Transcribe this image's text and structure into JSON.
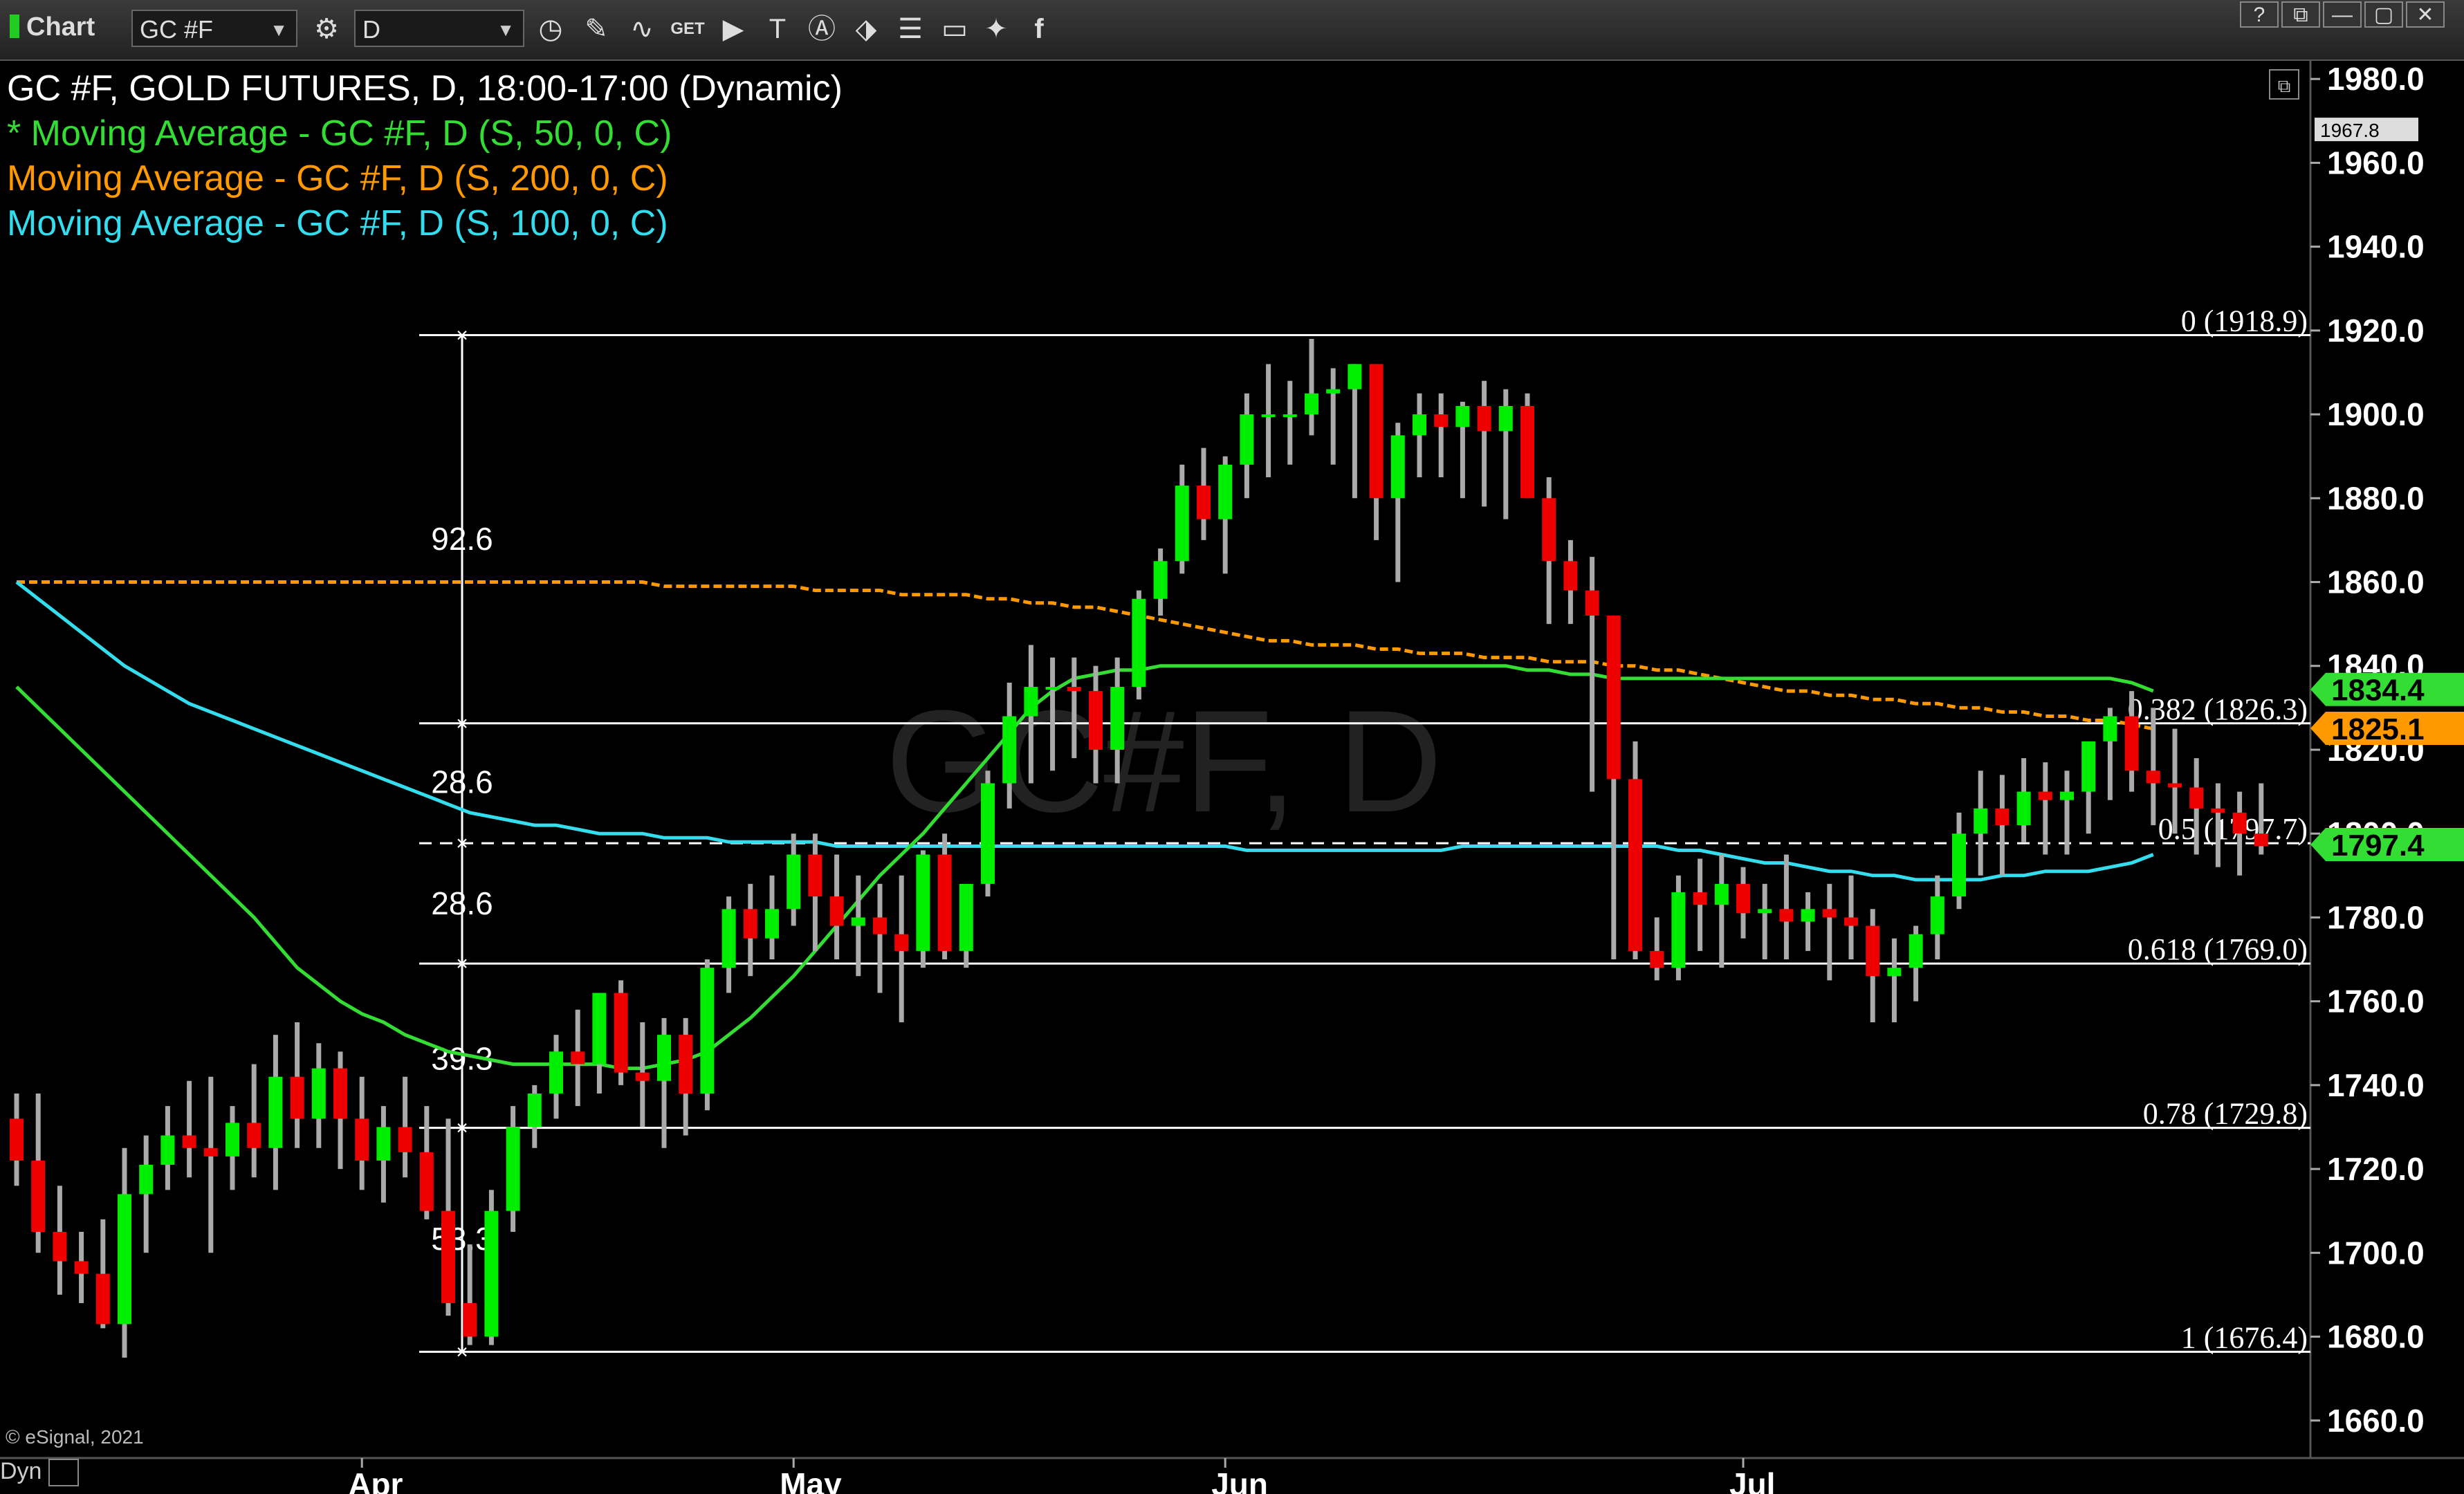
{
  "toolbar": {
    "title": "Chart",
    "symbol": "GC #F",
    "interval": "D",
    "icons": [
      "link-settings-icon",
      "clock-icon",
      "pencil-icon",
      "line-chart-icon",
      "get-icon",
      "play-icon",
      "text-tool-icon",
      "alert-icon",
      "magnet-icon",
      "list-icon",
      "comment-icon",
      "twitter-icon",
      "facebook-icon"
    ],
    "window_buttons": [
      "?",
      "⧉",
      "—",
      "▢",
      "✕"
    ]
  },
  "header": {
    "title": "GC #F, GOLD FUTURES, D, 18:00-17:00 (Dynamic)",
    "legend": [
      {
        "label": "* Moving Average - GC #F, D (S, 50, 0, C)",
        "color": "#33dd33"
      },
      {
        "label": "Moving Average - GC #F, D (S, 200, 0, C)",
        "color": "#ff9900"
      },
      {
        "label": "Moving Average - GC #F, D (S, 100, 0, C)",
        "color": "#33ddee"
      }
    ]
  },
  "watermark": "GC#F, D",
  "copyright": "© eSignal, 2021",
  "bottom_left": "Dyn",
  "chart_data": {
    "type": "candlestick",
    "y_ticks": [
      "1980.0",
      "1960.0",
      "1940.0",
      "1920.0",
      "1900.0",
      "1880.0",
      "1860.0",
      "1840.0",
      "1820.0",
      "1800.0",
      "1780.0",
      "1760.0",
      "1740.0",
      "1720.0",
      "1700.0",
      "1680.0",
      "1660.0"
    ],
    "y_tick_values": [
      1980,
      1960,
      1940,
      1920,
      1900,
      1880,
      1860,
      1840,
      1820,
      1800,
      1780,
      1760,
      1740,
      1720,
      1700,
      1680,
      1660
    ],
    "ylim": [
      1656,
      1983
    ],
    "x_labels": [
      {
        "label": "Apr",
        "bar": 16
      },
      {
        "label": "May",
        "bar": 36
      },
      {
        "label": "Jun",
        "bar": 56
      },
      {
        "label": "Jul",
        "bar": 80
      }
    ],
    "x_bars": 100,
    "grid": false,
    "up_color": "#00ee00",
    "down_color": "#ee0000",
    "wick_color": "#aaaaaa",
    "candles": [
      [
        1732,
        1738,
        1716,
        1722
      ],
      [
        1722,
        1738,
        1700,
        1705
      ],
      [
        1705,
        1716,
        1690,
        1698
      ],
      [
        1698,
        1705,
        1688,
        1695
      ],
      [
        1695,
        1708,
        1682,
        1683
      ],
      [
        1683,
        1725,
        1675,
        1714
      ],
      [
        1714,
        1728,
        1700,
        1721
      ],
      [
        1721,
        1735,
        1715,
        1728
      ],
      [
        1728,
        1741,
        1718,
        1725
      ],
      [
        1725,
        1742,
        1700,
        1723
      ],
      [
        1723,
        1735,
        1715,
        1731
      ],
      [
        1731,
        1745,
        1718,
        1725
      ],
      [
        1725,
        1752,
        1715,
        1742
      ],
      [
        1742,
        1755,
        1725,
        1732
      ],
      [
        1732,
        1750,
        1725,
        1744
      ],
      [
        1744,
        1748,
        1720,
        1732
      ],
      [
        1732,
        1742,
        1715,
        1722
      ],
      [
        1722,
        1735,
        1712,
        1730
      ],
      [
        1730,
        1742,
        1718,
        1724
      ],
      [
        1724,
        1735,
        1708,
        1710
      ],
      [
        1710,
        1732,
        1685,
        1688
      ],
      [
        1688,
        1702,
        1678,
        1680
      ],
      [
        1680,
        1715,
        1678,
        1710
      ],
      [
        1710,
        1735,
        1705,
        1730
      ],
      [
        1730,
        1740,
        1725,
        1738
      ],
      [
        1738,
        1752,
        1732,
        1748
      ],
      [
        1748,
        1758,
        1735,
        1745
      ],
      [
        1745,
        1762,
        1738,
        1762
      ],
      [
        1762,
        1765,
        1740,
        1743
      ],
      [
        1743,
        1755,
        1730,
        1741
      ],
      [
        1741,
        1756,
        1725,
        1752
      ],
      [
        1752,
        1756,
        1728,
        1738
      ],
      [
        1738,
        1770,
        1734,
        1768
      ],
      [
        1768,
        1785,
        1762,
        1782
      ],
      [
        1782,
        1788,
        1766,
        1775
      ],
      [
        1775,
        1790,
        1770,
        1782
      ],
      [
        1782,
        1800,
        1778,
        1795
      ],
      [
        1795,
        1800,
        1772,
        1785
      ],
      [
        1785,
        1795,
        1770,
        1778
      ],
      [
        1778,
        1790,
        1766,
        1780
      ],
      [
        1780,
        1788,
        1762,
        1776
      ],
      [
        1776,
        1790,
        1755,
        1772
      ],
      [
        1772,
        1796,
        1768,
        1795
      ],
      [
        1795,
        1800,
        1770,
        1772
      ],
      [
        1772,
        1785,
        1768,
        1788
      ],
      [
        1788,
        1815,
        1785,
        1812
      ],
      [
        1812,
        1836,
        1806,
        1828
      ],
      [
        1828,
        1845,
        1812,
        1835
      ],
      [
        1835,
        1842,
        1815,
        1835
      ],
      [
        1835,
        1842,
        1818,
        1834
      ],
      [
        1834,
        1840,
        1812,
        1820
      ],
      [
        1820,
        1842,
        1812,
        1835
      ],
      [
        1835,
        1858,
        1832,
        1856
      ],
      [
        1856,
        1868,
        1852,
        1865
      ],
      [
        1865,
        1888,
        1862,
        1883
      ],
      [
        1883,
        1892,
        1870,
        1875
      ],
      [
        1875,
        1890,
        1862,
        1888
      ],
      [
        1888,
        1905,
        1880,
        1900
      ],
      [
        1900,
        1912,
        1885,
        1900
      ],
      [
        1900,
        1908,
        1888,
        1900
      ],
      [
        1900,
        1918,
        1895,
        1905
      ],
      [
        1905,
        1911,
        1888,
        1906
      ],
      [
        1906,
        1912,
        1880,
        1912
      ],
      [
        1912,
        1908,
        1870,
        1880
      ],
      [
        1880,
        1898,
        1860,
        1895
      ],
      [
        1895,
        1905,
        1885,
        1900
      ],
      [
        1900,
        1905,
        1885,
        1897
      ],
      [
        1897,
        1903,
        1880,
        1902
      ],
      [
        1902,
        1908,
        1878,
        1896
      ],
      [
        1896,
        1906,
        1875,
        1902
      ],
      [
        1902,
        1905,
        1880,
        1880
      ],
      [
        1880,
        1885,
        1850,
        1865
      ],
      [
        1865,
        1870,
        1850,
        1858
      ],
      [
        1858,
        1866,
        1810,
        1852
      ],
      [
        1852,
        1825,
        1770,
        1813
      ],
      [
        1813,
        1822,
        1770,
        1772
      ],
      [
        1772,
        1780,
        1765,
        1768
      ],
      [
        1768,
        1790,
        1765,
        1786
      ],
      [
        1786,
        1794,
        1772,
        1783
      ],
      [
        1783,
        1795,
        1768,
        1788
      ],
      [
        1788,
        1792,
        1775,
        1781
      ],
      [
        1781,
        1788,
        1770,
        1782
      ],
      [
        1782,
        1795,
        1770,
        1779
      ],
      [
        1779,
        1786,
        1772,
        1782
      ],
      [
        1782,
        1788,
        1765,
        1780
      ],
      [
        1780,
        1790,
        1770,
        1778
      ],
      [
        1778,
        1782,
        1755,
        1766
      ],
      [
        1766,
        1775,
        1755,
        1768
      ],
      [
        1768,
        1778,
        1760,
        1776
      ],
      [
        1776,
        1790,
        1770,
        1785
      ],
      [
        1785,
        1805,
        1782,
        1800
      ],
      [
        1800,
        1815,
        1790,
        1806
      ],
      [
        1806,
        1814,
        1790,
        1802
      ],
      [
        1802,
        1818,
        1798,
        1810
      ],
      [
        1810,
        1817,
        1795,
        1808
      ],
      [
        1808,
        1815,
        1795,
        1810
      ],
      [
        1810,
        1820,
        1800,
        1822
      ],
      [
        1822,
        1830,
        1808,
        1828
      ],
      [
        1828,
        1834,
        1810,
        1815
      ],
      [
        1815,
        1830,
        1802,
        1812
      ],
      [
        1812,
        1825,
        1800,
        1811
      ],
      [
        1811,
        1818,
        1795,
        1806
      ],
      [
        1806,
        1812,
        1792,
        1805
      ],
      [
        1805,
        1810,
        1790,
        1800
      ],
      [
        1800,
        1812,
        1795,
        1797
      ]
    ],
    "ma200": [
      1860,
      1860,
      1860,
      1860,
      1860,
      1860,
      1860,
      1860,
      1860,
      1860,
      1860,
      1860,
      1860,
      1860,
      1860,
      1860,
      1860,
      1860,
      1860,
      1860,
      1860,
      1860,
      1860,
      1860,
      1860,
      1860,
      1860,
      1860,
      1860,
      1860,
      1859,
      1859,
      1859,
      1859,
      1859,
      1859,
      1859,
      1858,
      1858,
      1858,
      1858,
      1857,
      1857,
      1857,
      1857,
      1856,
      1856,
      1855,
      1855,
      1854,
      1854,
      1853,
      1852,
      1851,
      1850,
      1849,
      1848,
      1847,
      1846,
      1846,
      1845,
      1845,
      1845,
      1844,
      1844,
      1843,
      1843,
      1843,
      1842,
      1842,
      1842,
      1841,
      1841,
      1841,
      1840,
      1840,
      1839,
      1839,
      1838,
      1837,
      1836,
      1835,
      1834,
      1834,
      1833,
      1833,
      1832,
      1832,
      1831,
      1831,
      1830,
      1830,
      1829,
      1829,
      1828,
      1828,
      1827,
      1827,
      1826,
      1825
    ],
    "ma100": [
      1860,
      1856,
      1852,
      1848,
      1844,
      1840,
      1837,
      1834,
      1831,
      1829,
      1827,
      1825,
      1823,
      1821,
      1819,
      1817,
      1815,
      1813,
      1811,
      1809,
      1807,
      1805,
      1804,
      1803,
      1802,
      1802,
      1801,
      1800,
      1800,
      1800,
      1799,
      1799,
      1799,
      1798,
      1798,
      1798,
      1798,
      1798,
      1797,
      1797,
      1797,
      1797,
      1797,
      1797,
      1797,
      1797,
      1797,
      1797,
      1797,
      1797,
      1797,
      1797,
      1797,
      1797,
      1797,
      1797,
      1797,
      1796,
      1796,
      1796,
      1796,
      1796,
      1796,
      1796,
      1796,
      1796,
      1796,
      1797,
      1797,
      1797,
      1797,
      1797,
      1797,
      1797,
      1797,
      1797,
      1797,
      1796,
      1796,
      1795,
      1794,
      1793,
      1793,
      1792,
      1791,
      1791,
      1790,
      1790,
      1789,
      1789,
      1789,
      1789,
      1790,
      1790,
      1791,
      1791,
      1791,
      1792,
      1793,
      1795
    ],
    "ma50": [
      1835,
      1830,
      1825,
      1820,
      1815,
      1810,
      1805,
      1800,
      1795,
      1790,
      1785,
      1780,
      1774,
      1768,
      1764,
      1760,
      1757,
      1755,
      1752,
      1750,
      1748,
      1747,
      1746,
      1745,
      1745,
      1745,
      1745,
      1745,
      1744,
      1744,
      1745,
      1746,
      1748,
      1752,
      1756,
      1761,
      1766,
      1772,
      1778,
      1784,
      1790,
      1795,
      1800,
      1806,
      1812,
      1818,
      1824,
      1830,
      1834,
      1837,
      1838,
      1839,
      1839,
      1840,
      1840,
      1840,
      1840,
      1840,
      1840,
      1840,
      1840,
      1840,
      1840,
      1840,
      1840,
      1840,
      1840,
      1840,
      1840,
      1840,
      1839,
      1839,
      1838,
      1838,
      1837,
      1837,
      1837,
      1837,
      1837,
      1837,
      1837,
      1837,
      1837,
      1837,
      1837,
      1837,
      1837,
      1837,
      1837,
      1837,
      1837,
      1837,
      1837,
      1837,
      1837,
      1837,
      1837,
      1837,
      1836,
      1834
    ],
    "last_labels": [
      {
        "value": 1834.4,
        "label": "1834.4",
        "color": "#33dd33"
      },
      {
        "value": 1825.1,
        "label": "1825.1",
        "color": "#ff9900"
      },
      {
        "value": 1797.4,
        "label": "1797.4",
        "color": "#33dd33"
      }
    ],
    "top_readout": "1967.8",
    "fib_levels": [
      {
        "value": 1918.9,
        "label": "0 (1918.9)",
        "dashed": false
      },
      {
        "value": 1826.3,
        "label": "0.382 (1826.3)",
        "dashed": false
      },
      {
        "value": 1797.7,
        "label": "0.5 (1797.7)",
        "dashed": true
      },
      {
        "value": 1769.0,
        "label": "0.618 (1769.0)",
        "dashed": false
      },
      {
        "value": 1729.8,
        "label": "0.78 (1729.8)",
        "dashed": false
      },
      {
        "value": 1676.4,
        "label": "1 (1676.4)",
        "dashed": false
      }
    ],
    "fib_range_labels": [
      {
        "value": 1870,
        "label": "92.6"
      },
      {
        "value": 1812,
        "label": "28.6"
      },
      {
        "value": 1783,
        "label": "28.6"
      },
      {
        "value": 1746,
        "label": "39.3"
      },
      {
        "value": 1703,
        "label": "53.3"
      }
    ]
  }
}
